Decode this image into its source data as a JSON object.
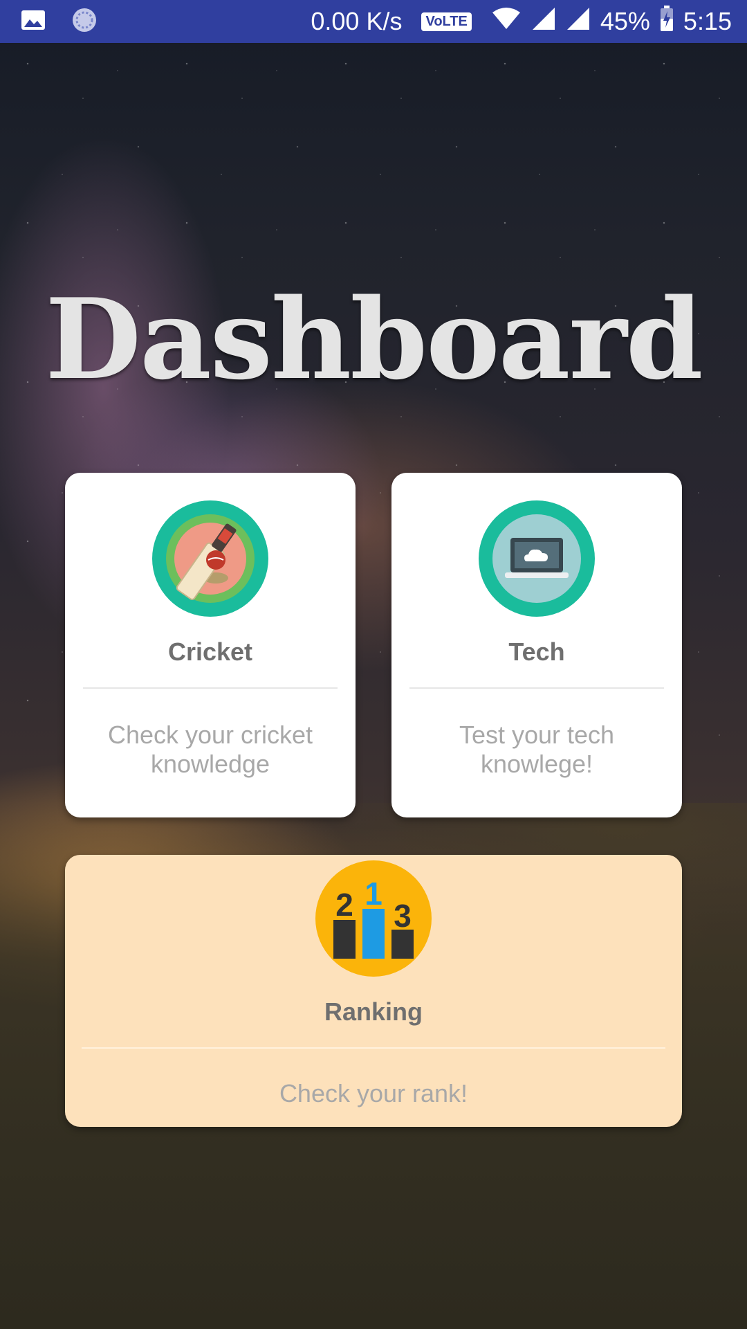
{
  "status_bar": {
    "network_speed": "0.00 K/s",
    "volte_label": "VoLTE",
    "battery": "45%",
    "time": "5:15",
    "icons": [
      "image-notification-icon",
      "sync-notification-icon",
      "wifi-icon",
      "signal-icon",
      "battery-icon"
    ]
  },
  "page": {
    "title": "Dashboard"
  },
  "cards": {
    "cricket": {
      "title": "Cricket",
      "description": "Check your cricket knowledge",
      "icon": "cricket-bat-icon"
    },
    "tech": {
      "title": "Tech",
      "description": "Test your tech knowlege!",
      "icon": "laptop-cloud-icon"
    },
    "ranking": {
      "title": "Ranking",
      "description": "Check your rank!",
      "icon": "podium-icon",
      "podium": [
        "2",
        "1",
        "3"
      ]
    }
  },
  "colors": {
    "status_bar": "#303f9f",
    "icon_ring": "#1abc9c",
    "ranking_card": "#fde1bb",
    "ranking_icon": "#fbb40a",
    "podium_first": "#1e9be3"
  }
}
